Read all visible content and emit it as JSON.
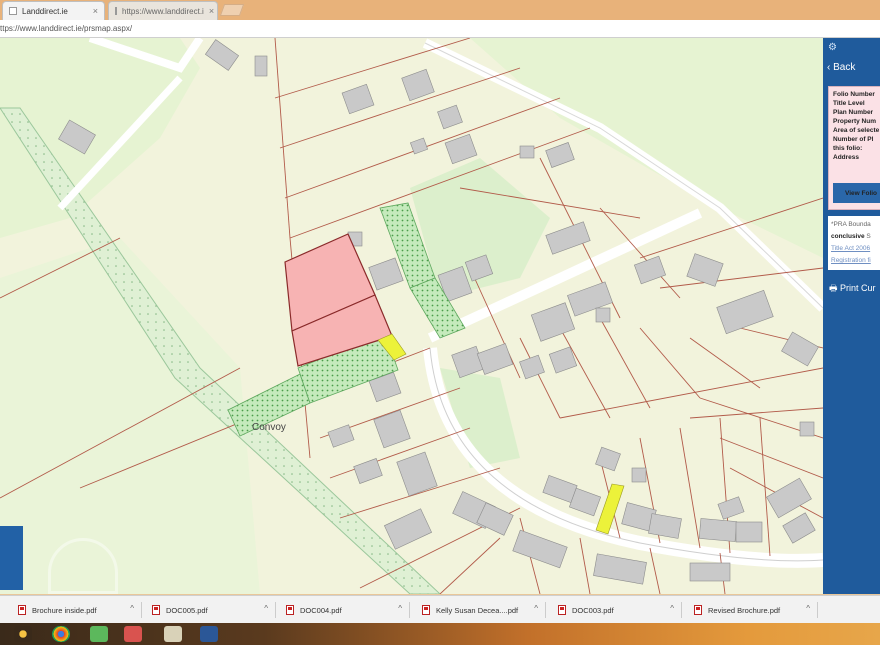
{
  "browser": {
    "tabs": [
      {
        "title": "Landdirect.ie",
        "close": "×"
      },
      {
        "title": "https://www.landdirect.i",
        "close": "×"
      }
    ],
    "url": "ttps://www.landdirect.ie/prsmap.aspx/"
  },
  "map": {
    "place_label": "Convoy"
  },
  "panel": {
    "back_label": "Back",
    "fields": [
      "Folio Number",
      "Title Level",
      "Plan Number",
      "Property Num",
      "Area of selecte",
      "Number of Pl",
      "this folio:",
      "Address"
    ],
    "view_button": "View Folio",
    "note_lines": [
      "*PRA Bounda",
      "conclusive",
      "Title Act 2006",
      "Registration fi"
    ],
    "note_bold_word": "conclusive",
    "note_after_bold": "S",
    "print_label": "Print Cur"
  },
  "downloads": [
    {
      "name": "Brochure inside.pdf"
    },
    {
      "name": "DOC005.pdf"
    },
    {
      "name": "DOC004.pdf"
    },
    {
      "name": "Kelly Susan Decea....pdf"
    },
    {
      "name": "DOC003.pdf"
    },
    {
      "name": "Revised Brochure.pdf"
    }
  ],
  "icons": {
    "gear": "⚙",
    "back_chevron": "›",
    "print": "🖶",
    "download_chevron": "^"
  },
  "colors": {
    "map_bg": "#f2f3dc",
    "parcel_selected": "#f7b3b3",
    "parcel_highlight": "#ecf23a",
    "parcel_green": "#bfe8b6",
    "boundary": "#b25b4a",
    "panel_blue": "#1f5b9c"
  }
}
